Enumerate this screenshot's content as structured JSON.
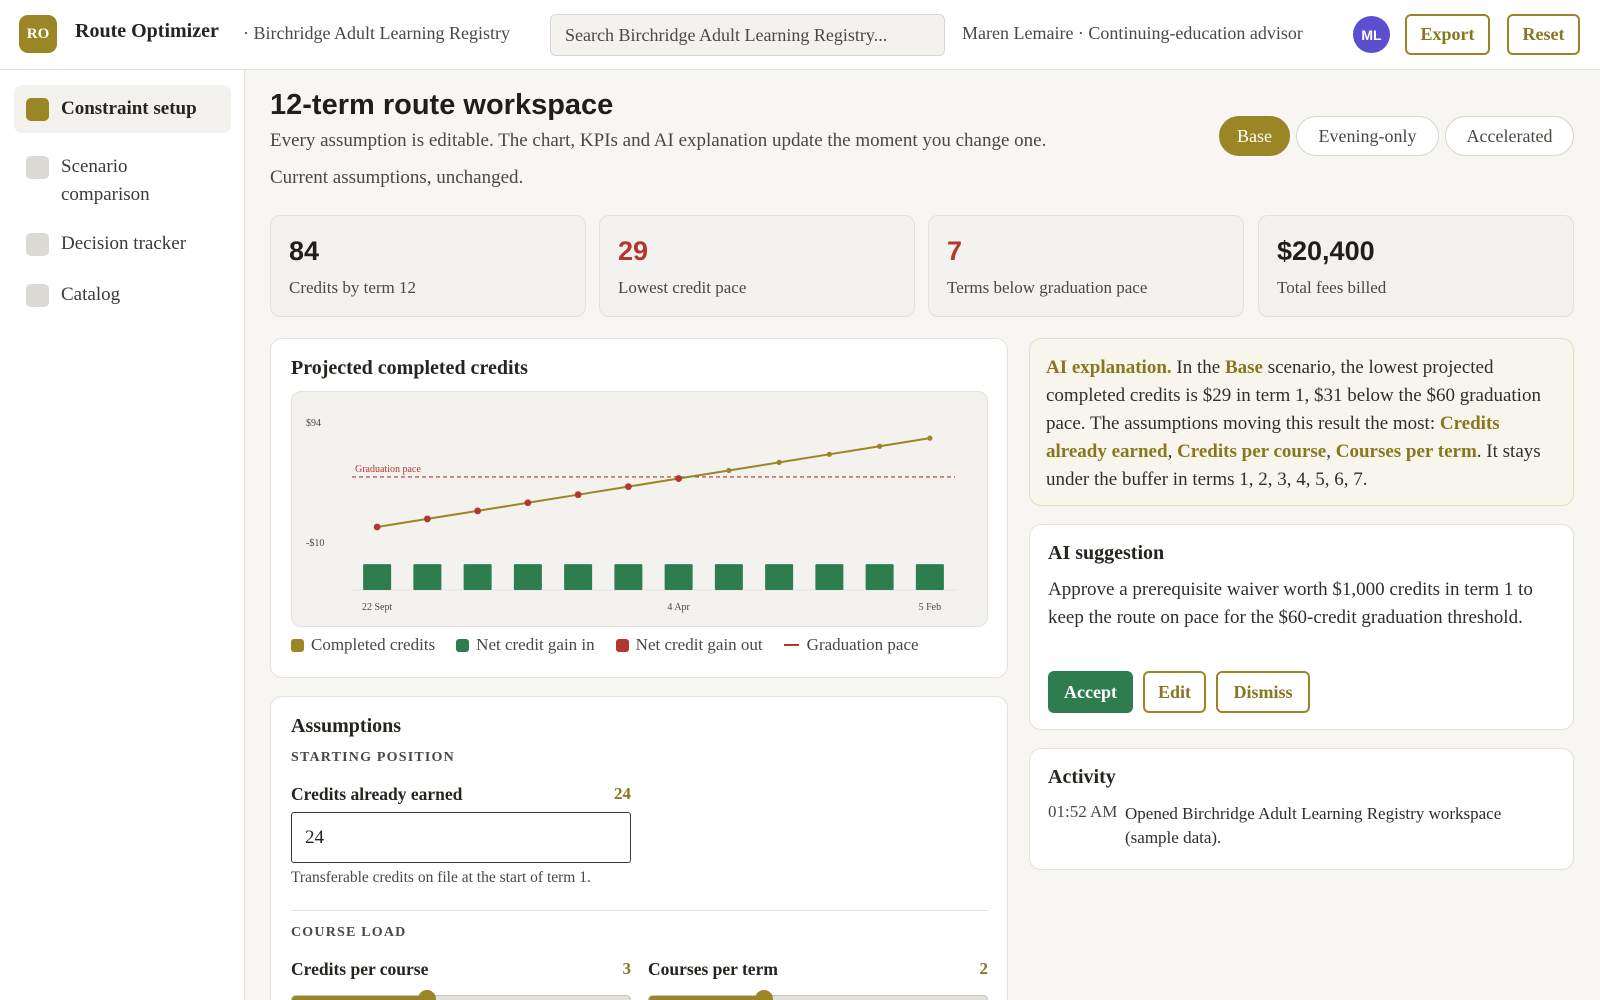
{
  "app": {
    "logo_text": "RO",
    "title": "Route Optimizer",
    "registry": "· Birchridge Adult Learning Registry",
    "search_placeholder": "Search Birchridge Adult Learning Registry...",
    "user": "Maren Lemaire · Continuing-education advisor",
    "avatar": "ML",
    "export_label": "Export",
    "reset_label": "Reset"
  },
  "sidebar": {
    "items": [
      {
        "label": "Constraint setup",
        "active": true
      },
      {
        "label": "Scenario comparison",
        "active": false
      },
      {
        "label": "Decision tracker",
        "active": false
      },
      {
        "label": "Catalog",
        "active": false
      }
    ]
  },
  "main": {
    "title": "12-term route workspace",
    "subtitle": "Every assumption is editable. The chart, KPIs and AI explanation update the moment you change one.",
    "status": "Current assumptions, unchanged.",
    "scenarios": [
      "Base",
      "Evening-only",
      "Accelerated"
    ],
    "active_scenario": "Base"
  },
  "kpis": [
    {
      "value": "84",
      "label": "Credits by term 12",
      "tone": "neutral"
    },
    {
      "value": "29",
      "label": "Lowest credit pace",
      "tone": "negative"
    },
    {
      "value": "7",
      "label": "Terms below graduation pace",
      "tone": "negative"
    },
    {
      "value": "$20,400",
      "label": "Total fees billed",
      "tone": "neutral"
    }
  ],
  "chart_panel": {
    "title": "Projected completed credits",
    "legend": [
      {
        "label": "Completed credits",
        "color": "#9a8625",
        "shape": "square"
      },
      {
        "label": "Net credit gain in",
        "color": "#2e7d4e",
        "shape": "square"
      },
      {
        "label": "Net credit gain out",
        "color": "#b3362f",
        "shape": "square"
      },
      {
        "label": "Graduation pace",
        "color": "#b3362f",
        "shape": "line"
      }
    ]
  },
  "chart_data": {
    "type": "line",
    "title": "Projected completed credits",
    "x_tick_labels": [
      "22 Sept",
      "4 Apr",
      "5 Feb"
    ],
    "y_tick_labels": [
      "$94",
      "-$10"
    ],
    "ylim": [
      -10,
      94
    ],
    "series": [
      {
        "name": "Completed credits",
        "type": "line",
        "values": [
          29,
          34,
          39,
          44,
          49,
          54,
          59,
          64,
          69,
          74,
          79,
          84
        ]
      },
      {
        "name": "Net credit gain in",
        "type": "bar",
        "values": [
          6,
          6,
          6,
          6,
          6,
          6,
          6,
          6,
          6,
          6,
          6,
          6
        ]
      }
    ],
    "reference_line": {
      "name": "Graduation pace",
      "label": "Graduation pace",
      "value": 60
    },
    "grid": false,
    "legend_position": "bottom"
  },
  "explanation": {
    "lead": "AI explanation.",
    "t1": " In the ",
    "scenario": "Base",
    "t2": " scenario, the lowest projected completed credits is $29 in term 1, $31 below the $60 graduation pace. The assumptions moving this result the most: ",
    "a1": "Credits already earned",
    "sep1": ", ",
    "a2": "Credits per course",
    "sep2": ", ",
    "a3": "Courses per term",
    "t3": ". It stays under the buffer in terms 1, 2, 3, 4, 5, 6, 7."
  },
  "suggestion": {
    "title": "AI suggestion",
    "text": "Approve a prerequisite waiver worth $1,000 credits in term 1 to keep the route on pace for the $60-credit graduation threshold.",
    "accept": "Accept",
    "edit": "Edit",
    "dismiss": "Dismiss"
  },
  "activity": {
    "title": "Activity",
    "items": [
      {
        "time": "01:52 AM",
        "text": "Opened Birchridge Adult Learning Registry workspace (sample data)."
      }
    ]
  },
  "assumptions": {
    "title": "Assumptions",
    "starting_section": "STARTING POSITION",
    "credits_earned_label": "Credits already earned",
    "credits_earned_value": "24",
    "credits_earned_help": "Transferable credits on file at the start of term 1.",
    "course_load_section": "COURSE LOAD",
    "credits_per_course_label": "Credits per course",
    "credits_per_course_value": "3",
    "credits_per_course_fraction": 0.4,
    "courses_per_term_label": "Courses per term",
    "courses_per_term_value": "2",
    "courses_per_term_fraction": 0.34
  }
}
